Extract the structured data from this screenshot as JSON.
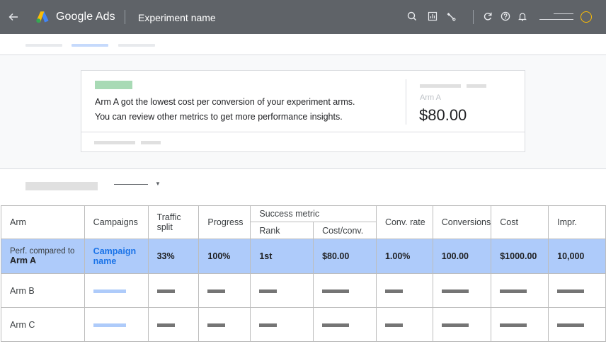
{
  "header": {
    "back_icon": "arrow-back-icon",
    "product_name": "Google Ads",
    "page_title": "Experiment name",
    "icons": [
      "search-icon",
      "reports-icon",
      "tools-icon",
      "refresh-icon",
      "help-icon",
      "notifications-icon"
    ],
    "avatar_color": "#fbbc04",
    "bar_color": "#5f6368"
  },
  "insight": {
    "line1": "Arm A got the lowest cost per conversion of your experiment arms.",
    "line2": "You can review other metrics to get more performance insights.",
    "metric_label": "Arm A",
    "metric_value": "$80.00",
    "tag_color": "#a8dab5"
  },
  "table": {
    "headers": {
      "arm": "Arm",
      "campaigns": "Campaigns",
      "traffic_split": "Traffic split",
      "progress": "Progress",
      "success_metric": "Success metric",
      "rank": "Rank",
      "cost_conv": "Cost/conv.",
      "conv_rate": "Conv. rate",
      "conversions": "Conversions",
      "cost": "Cost",
      "impr": "Impr."
    },
    "highlight_row": {
      "arm_prefix": "Perf. compared to",
      "arm": "Arm A",
      "campaign": "Campaign name",
      "traffic_split": "33%",
      "progress": "100%",
      "rank": "1st",
      "cost_conv": "$80.00",
      "conv_rate": "1.00%",
      "conversions": "100.00",
      "cost": "$1000.00",
      "impr": "10,000",
      "row_color": "#aecbfa",
      "link_color": "#1a73e8"
    },
    "rows": [
      {
        "arm": "Arm B"
      },
      {
        "arm": "Arm C"
      }
    ]
  }
}
